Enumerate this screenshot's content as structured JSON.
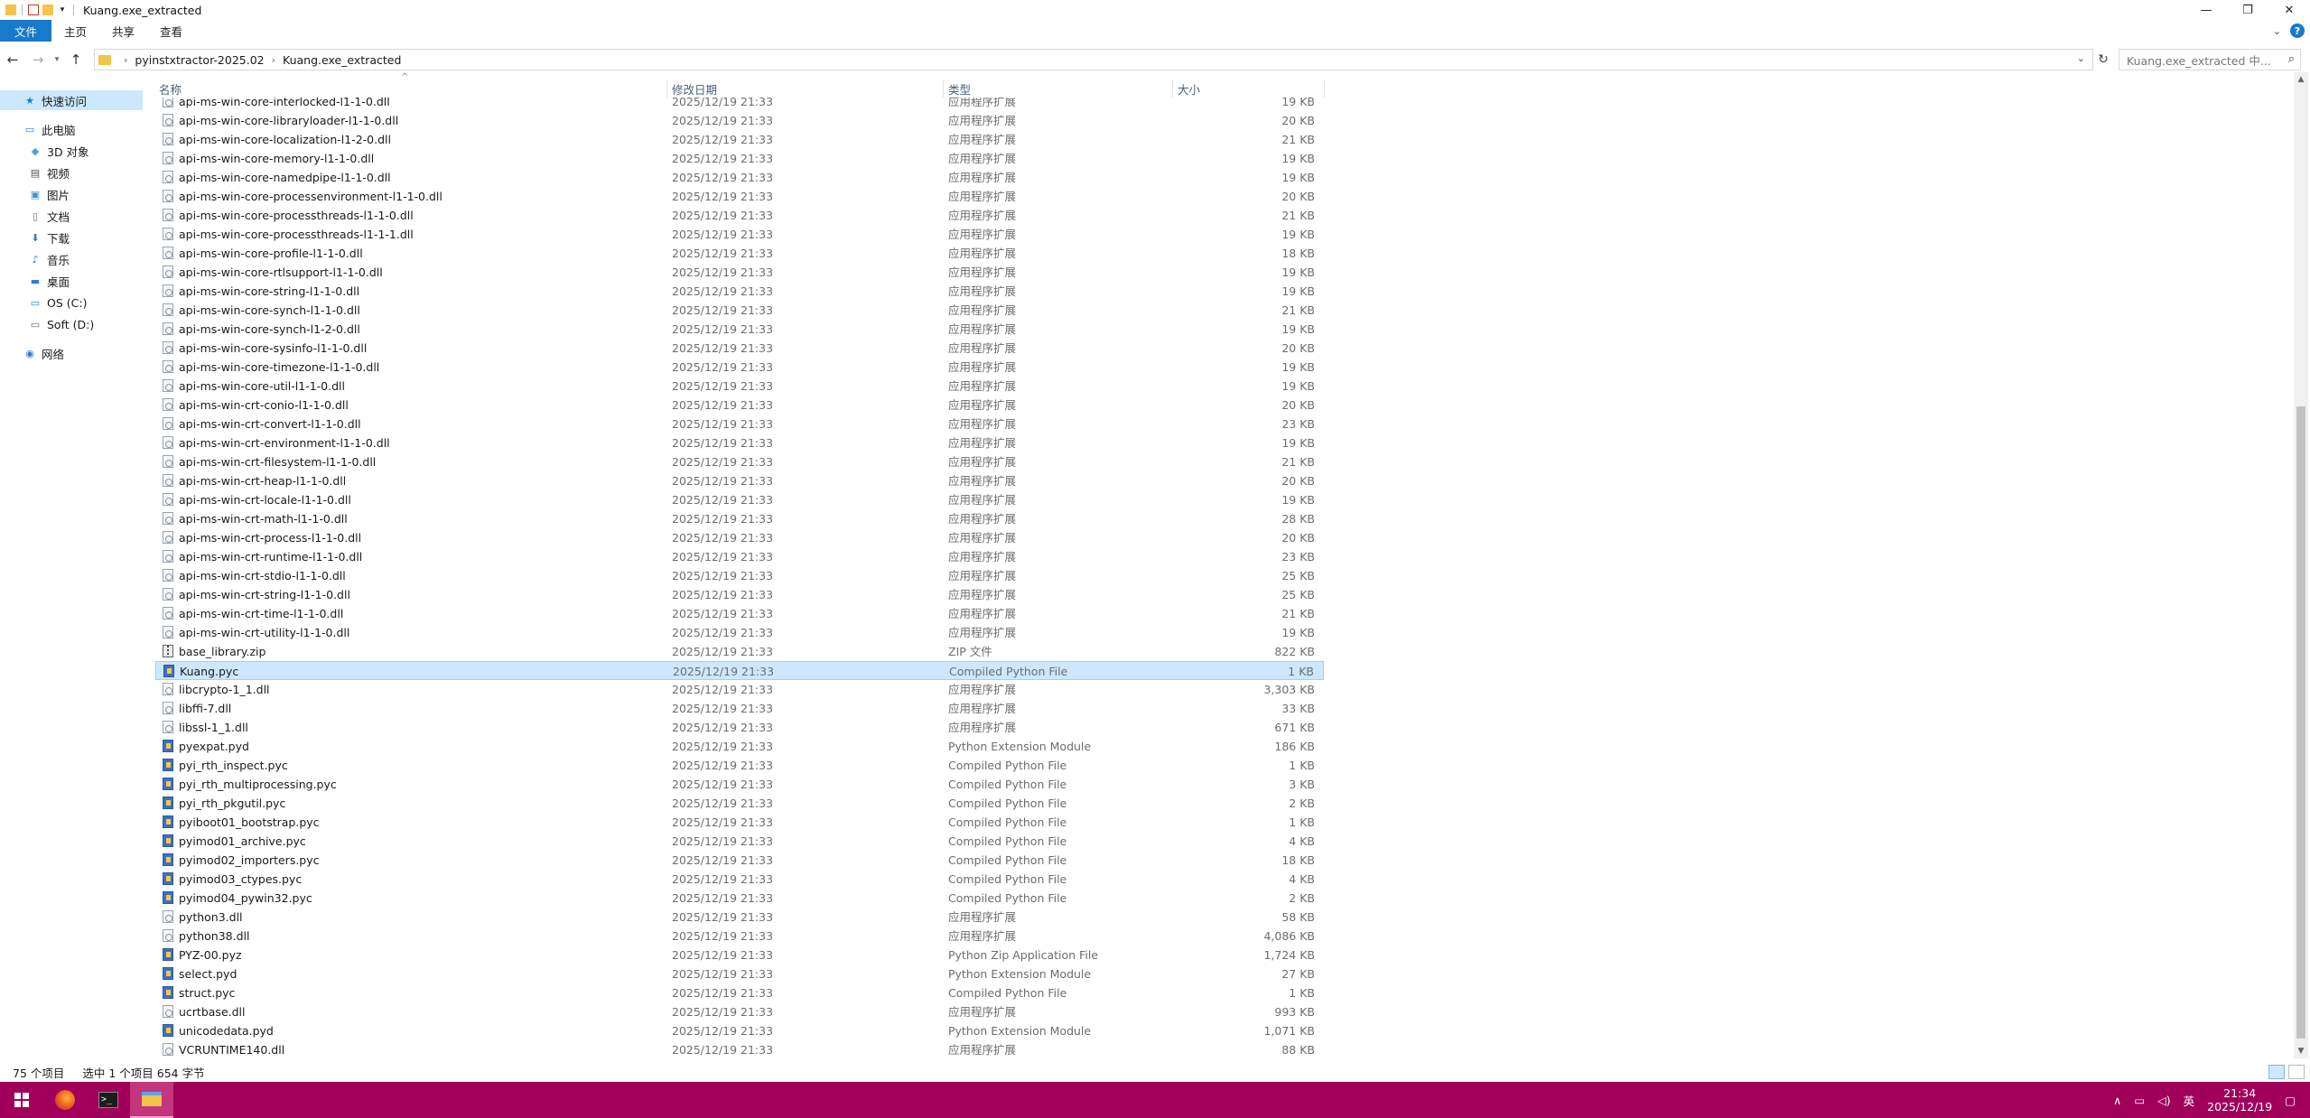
{
  "window": {
    "title": "Kuang.exe_extracted",
    "minimize": "—",
    "maximize": "❐",
    "close": "✕"
  },
  "ribbon": {
    "tabs": [
      "文件",
      "主页",
      "共享",
      "查看"
    ],
    "collapse": "⌄",
    "help": "?"
  },
  "address": {
    "crumbs": [
      "pyinstxtractor-2025.02",
      "Kuang.exe_extracted"
    ],
    "search_placeholder": "搜索\"Kuang.exe_extracted 中...\"",
    "search_display": "Kuang.exe_extracted 中..."
  },
  "nav": {
    "items": [
      {
        "label": "快速访问",
        "icon": "star-icon"
      },
      {
        "label": "此电脑",
        "icon": "computer-icon"
      },
      {
        "label": "3D 对象",
        "icon": "cube-icon"
      },
      {
        "label": "视频",
        "icon": "video-icon"
      },
      {
        "label": "图片",
        "icon": "picture-icon"
      },
      {
        "label": "文档",
        "icon": "document-icon"
      },
      {
        "label": "下载",
        "icon": "download-icon"
      },
      {
        "label": "音乐",
        "icon": "music-icon"
      },
      {
        "label": "桌面",
        "icon": "desktop-icon"
      },
      {
        "label": "OS (C:)",
        "icon": "drive-icon"
      },
      {
        "label": "Soft (D:)",
        "icon": "drive-icon"
      },
      {
        "label": "网络",
        "icon": "network-icon"
      }
    ]
  },
  "columns": {
    "name": "名称",
    "date": "修改日期",
    "type": "类型",
    "size": "大小"
  },
  "files": [
    {
      "name": "api-ms-win-core-interlocked-l1-1-0.dll",
      "date": "2025/12/19 21:33",
      "type": "应用程序扩展",
      "size": "19 KB",
      "icon": "dll"
    },
    {
      "name": "api-ms-win-core-libraryloader-l1-1-0.dll",
      "date": "2025/12/19 21:33",
      "type": "应用程序扩展",
      "size": "20 KB",
      "icon": "dll"
    },
    {
      "name": "api-ms-win-core-localization-l1-2-0.dll",
      "date": "2025/12/19 21:33",
      "type": "应用程序扩展",
      "size": "21 KB",
      "icon": "dll"
    },
    {
      "name": "api-ms-win-core-memory-l1-1-0.dll",
      "date": "2025/12/19 21:33",
      "type": "应用程序扩展",
      "size": "19 KB",
      "icon": "dll"
    },
    {
      "name": "api-ms-win-core-namedpipe-l1-1-0.dll",
      "date": "2025/12/19 21:33",
      "type": "应用程序扩展",
      "size": "19 KB",
      "icon": "dll"
    },
    {
      "name": "api-ms-win-core-processenvironment-l1-1-0.dll",
      "date": "2025/12/19 21:33",
      "type": "应用程序扩展",
      "size": "20 KB",
      "icon": "dll"
    },
    {
      "name": "api-ms-win-core-processthreads-l1-1-0.dll",
      "date": "2025/12/19 21:33",
      "type": "应用程序扩展",
      "size": "21 KB",
      "icon": "dll"
    },
    {
      "name": "api-ms-win-core-processthreads-l1-1-1.dll",
      "date": "2025/12/19 21:33",
      "type": "应用程序扩展",
      "size": "19 KB",
      "icon": "dll"
    },
    {
      "name": "api-ms-win-core-profile-l1-1-0.dll",
      "date": "2025/12/19 21:33",
      "type": "应用程序扩展",
      "size": "18 KB",
      "icon": "dll"
    },
    {
      "name": "api-ms-win-core-rtlsupport-l1-1-0.dll",
      "date": "2025/12/19 21:33",
      "type": "应用程序扩展",
      "size": "19 KB",
      "icon": "dll"
    },
    {
      "name": "api-ms-win-core-string-l1-1-0.dll",
      "date": "2025/12/19 21:33",
      "type": "应用程序扩展",
      "size": "19 KB",
      "icon": "dll"
    },
    {
      "name": "api-ms-win-core-synch-l1-1-0.dll",
      "date": "2025/12/19 21:33",
      "type": "应用程序扩展",
      "size": "21 KB",
      "icon": "dll"
    },
    {
      "name": "api-ms-win-core-synch-l1-2-0.dll",
      "date": "2025/12/19 21:33",
      "type": "应用程序扩展",
      "size": "19 KB",
      "icon": "dll"
    },
    {
      "name": "api-ms-win-core-sysinfo-l1-1-0.dll",
      "date": "2025/12/19 21:33",
      "type": "应用程序扩展",
      "size": "20 KB",
      "icon": "dll"
    },
    {
      "name": "api-ms-win-core-timezone-l1-1-0.dll",
      "date": "2025/12/19 21:33",
      "type": "应用程序扩展",
      "size": "19 KB",
      "icon": "dll"
    },
    {
      "name": "api-ms-win-core-util-l1-1-0.dll",
      "date": "2025/12/19 21:33",
      "type": "应用程序扩展",
      "size": "19 KB",
      "icon": "dll"
    },
    {
      "name": "api-ms-win-crt-conio-l1-1-0.dll",
      "date": "2025/12/19 21:33",
      "type": "应用程序扩展",
      "size": "20 KB",
      "icon": "dll"
    },
    {
      "name": "api-ms-win-crt-convert-l1-1-0.dll",
      "date": "2025/12/19 21:33",
      "type": "应用程序扩展",
      "size": "23 KB",
      "icon": "dll"
    },
    {
      "name": "api-ms-win-crt-environment-l1-1-0.dll",
      "date": "2025/12/19 21:33",
      "type": "应用程序扩展",
      "size": "19 KB",
      "icon": "dll"
    },
    {
      "name": "api-ms-win-crt-filesystem-l1-1-0.dll",
      "date": "2025/12/19 21:33",
      "type": "应用程序扩展",
      "size": "21 KB",
      "icon": "dll"
    },
    {
      "name": "api-ms-win-crt-heap-l1-1-0.dll",
      "date": "2025/12/19 21:33",
      "type": "应用程序扩展",
      "size": "20 KB",
      "icon": "dll"
    },
    {
      "name": "api-ms-win-crt-locale-l1-1-0.dll",
      "date": "2025/12/19 21:33",
      "type": "应用程序扩展",
      "size": "19 KB",
      "icon": "dll"
    },
    {
      "name": "api-ms-win-crt-math-l1-1-0.dll",
      "date": "2025/12/19 21:33",
      "type": "应用程序扩展",
      "size": "28 KB",
      "icon": "dll"
    },
    {
      "name": "api-ms-win-crt-process-l1-1-0.dll",
      "date": "2025/12/19 21:33",
      "type": "应用程序扩展",
      "size": "20 KB",
      "icon": "dll"
    },
    {
      "name": "api-ms-win-crt-runtime-l1-1-0.dll",
      "date": "2025/12/19 21:33",
      "type": "应用程序扩展",
      "size": "23 KB",
      "icon": "dll"
    },
    {
      "name": "api-ms-win-crt-stdio-l1-1-0.dll",
      "date": "2025/12/19 21:33",
      "type": "应用程序扩展",
      "size": "25 KB",
      "icon": "dll"
    },
    {
      "name": "api-ms-win-crt-string-l1-1-0.dll",
      "date": "2025/12/19 21:33",
      "type": "应用程序扩展",
      "size": "25 KB",
      "icon": "dll"
    },
    {
      "name": "api-ms-win-crt-time-l1-1-0.dll",
      "date": "2025/12/19 21:33",
      "type": "应用程序扩展",
      "size": "21 KB",
      "icon": "dll"
    },
    {
      "name": "api-ms-win-crt-utility-l1-1-0.dll",
      "date": "2025/12/19 21:33",
      "type": "应用程序扩展",
      "size": "19 KB",
      "icon": "dll"
    },
    {
      "name": "base_library.zip",
      "date": "2025/12/19 21:33",
      "type": "ZIP 文件",
      "size": "822 KB",
      "icon": "zip"
    },
    {
      "name": "Kuang.pyc",
      "date": "2025/12/19 21:33",
      "type": "Compiled Python File",
      "size": "1 KB",
      "icon": "py",
      "selected": true
    },
    {
      "name": "libcrypto-1_1.dll",
      "date": "2025/12/19 21:33",
      "type": "应用程序扩展",
      "size": "3,303 KB",
      "icon": "dll"
    },
    {
      "name": "libffi-7.dll",
      "date": "2025/12/19 21:33",
      "type": "应用程序扩展",
      "size": "33 KB",
      "icon": "dll"
    },
    {
      "name": "libssl-1_1.dll",
      "date": "2025/12/19 21:33",
      "type": "应用程序扩展",
      "size": "671 KB",
      "icon": "dll"
    },
    {
      "name": "pyexpat.pyd",
      "date": "2025/12/19 21:33",
      "type": "Python Extension Module",
      "size": "186 KB",
      "icon": "py"
    },
    {
      "name": "pyi_rth_inspect.pyc",
      "date": "2025/12/19 21:33",
      "type": "Compiled Python File",
      "size": "1 KB",
      "icon": "py"
    },
    {
      "name": "pyi_rth_multiprocessing.pyc",
      "date": "2025/12/19 21:33",
      "type": "Compiled Python File",
      "size": "3 KB",
      "icon": "py"
    },
    {
      "name": "pyi_rth_pkgutil.pyc",
      "date": "2025/12/19 21:33",
      "type": "Compiled Python File",
      "size": "2 KB",
      "icon": "py"
    },
    {
      "name": "pyiboot01_bootstrap.pyc",
      "date": "2025/12/19 21:33",
      "type": "Compiled Python File",
      "size": "1 KB",
      "icon": "py"
    },
    {
      "name": "pyimod01_archive.pyc",
      "date": "2025/12/19 21:33",
      "type": "Compiled Python File",
      "size": "4 KB",
      "icon": "py"
    },
    {
      "name": "pyimod02_importers.pyc",
      "date": "2025/12/19 21:33",
      "type": "Compiled Python File",
      "size": "18 KB",
      "icon": "py"
    },
    {
      "name": "pyimod03_ctypes.pyc",
      "date": "2025/12/19 21:33",
      "type": "Compiled Python File",
      "size": "4 KB",
      "icon": "py"
    },
    {
      "name": "pyimod04_pywin32.pyc",
      "date": "2025/12/19 21:33",
      "type": "Compiled Python File",
      "size": "2 KB",
      "icon": "py"
    },
    {
      "name": "python3.dll",
      "date": "2025/12/19 21:33",
      "type": "应用程序扩展",
      "size": "58 KB",
      "icon": "dll"
    },
    {
      "name": "python38.dll",
      "date": "2025/12/19 21:33",
      "type": "应用程序扩展",
      "size": "4,086 KB",
      "icon": "dll"
    },
    {
      "name": "PYZ-00.pyz",
      "date": "2025/12/19 21:33",
      "type": "Python Zip Application File",
      "size": "1,724 KB",
      "icon": "py"
    },
    {
      "name": "select.pyd",
      "date": "2025/12/19 21:33",
      "type": "Python Extension Module",
      "size": "27 KB",
      "icon": "py"
    },
    {
      "name": "struct.pyc",
      "date": "2025/12/19 21:33",
      "type": "Compiled Python File",
      "size": "1 KB",
      "icon": "py"
    },
    {
      "name": "ucrtbase.dll",
      "date": "2025/12/19 21:33",
      "type": "应用程序扩展",
      "size": "993 KB",
      "icon": "dll"
    },
    {
      "name": "unicodedata.pyd",
      "date": "2025/12/19 21:33",
      "type": "Python Extension Module",
      "size": "1,071 KB",
      "icon": "py"
    },
    {
      "name": "VCRUNTIME140.dll",
      "date": "2025/12/19 21:33",
      "type": "应用程序扩展",
      "size": "88 KB",
      "icon": "dll"
    }
  ],
  "status": {
    "count": "75 个项目",
    "selection": "选中 1 个项目  654 字节"
  },
  "taskbar": {
    "time": "21:34",
    "date": "2025/12/19",
    "ime": "英",
    "tray_chevron": "∧"
  }
}
